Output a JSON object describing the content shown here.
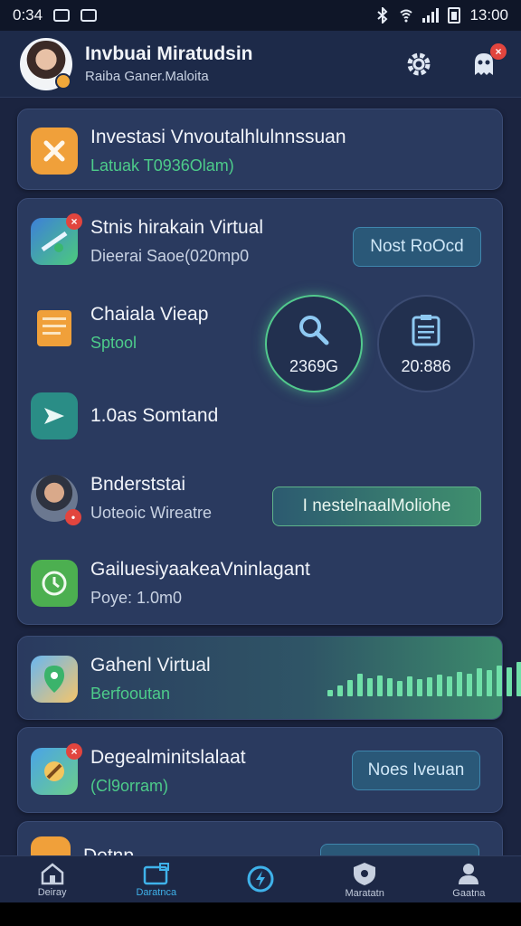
{
  "status_bar": {
    "time_left": "0:34",
    "time_right": "13:00"
  },
  "header": {
    "title": "Invbuai Miratudsin",
    "subtitle": "Raiba Ganer.Maloita"
  },
  "cards": {
    "investasi": {
      "title": "Investasi Vnvoutalhlulnnssuan",
      "sub": "Latuak T0936Olam)"
    },
    "group": {
      "item1": {
        "title": "Stnis hirakain Virtual",
        "sub": "Dieerai Saoe(020mp0",
        "button": "Nost RoOcd"
      },
      "item2": {
        "title": "Chaiala Vieap",
        "sub": "Sptool",
        "circle1_value": "2369G",
        "circle2_value": "20:886"
      },
      "item3": {
        "title": "1.0as Somtand"
      },
      "item4": {
        "title": "Bnderststai",
        "sub": "Uoteoic Wireatre",
        "button": "I nestelnaalMoliohe"
      },
      "item5": {
        "title": "GailuesiyaakeaVninlagant",
        "sub": "Poye: 1.0m0"
      }
    },
    "gahenl": {
      "title": "Gahenl Virtual",
      "sub": "Berfooutan",
      "bars": [
        0.18,
        0.3,
        0.45,
        0.62,
        0.5,
        0.58,
        0.5,
        0.42,
        0.55,
        0.48,
        0.52,
        0.6,
        0.55,
        0.68,
        0.62,
        0.78,
        0.72,
        0.86,
        0.8,
        0.96
      ]
    },
    "degeal": {
      "title": "Degealminitslalaat",
      "sub": "(Cl9orram)",
      "button": "Noes Iveuan"
    },
    "partial": {
      "title": "Detnp"
    }
  },
  "bottom_nav": [
    {
      "label": "Deiray",
      "icon": "home-icon"
    },
    {
      "label": "Daratnca",
      "icon": "folder-icon",
      "active": true
    },
    {
      "label": "",
      "icon": "circle-bolt-icon"
    },
    {
      "label": "Maratatn",
      "icon": "shield-icon"
    },
    {
      "label": "Gaatna",
      "icon": "user-icon"
    }
  ],
  "colors": {
    "background": "#1b2440",
    "card": "#2a3a5f",
    "accent_green": "#4dcc8a",
    "accent_blue": "#3fb2ea"
  }
}
